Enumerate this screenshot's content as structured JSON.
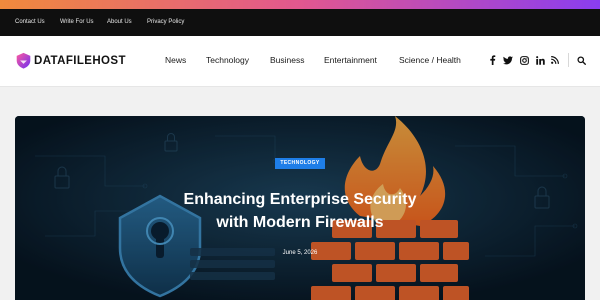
{
  "topbar": {
    "links": [
      "Contact Us",
      "Write For Us",
      "About Us",
      "Privacy Policy"
    ]
  },
  "header": {
    "logo_text": "DATAFILEHOST",
    "nav": [
      "News",
      "Technology",
      "Business",
      "Entertainment",
      "Science / Health"
    ],
    "social_icons": [
      "facebook-icon",
      "twitter-icon",
      "instagram-icon",
      "linkedin-icon",
      "rss-icon"
    ],
    "search_icon": "search-icon"
  },
  "hero": {
    "category": "TECHNOLOGY",
    "title_line1": "Enhancing Enterprise Security",
    "title_line2": "with Modern Firewalls",
    "date": "June 5, 2026"
  },
  "colors": {
    "accent": "#1e7ee8",
    "gradient": [
      "#f08a3c",
      "#e2578f",
      "#8a3df0"
    ],
    "topbar_bg": "#0f0f0f"
  }
}
